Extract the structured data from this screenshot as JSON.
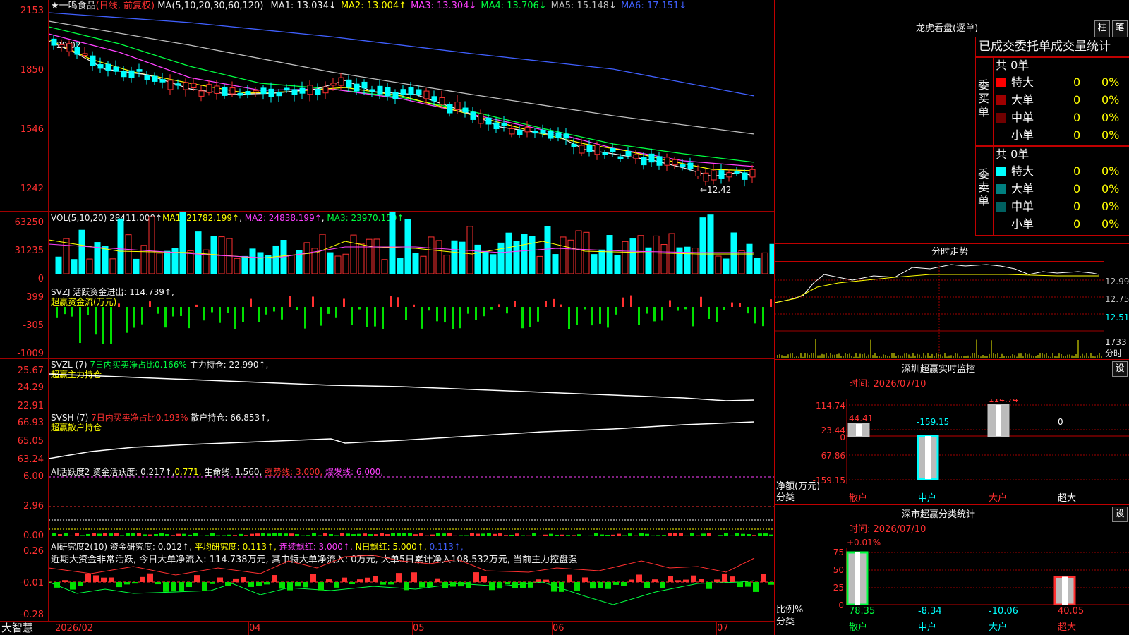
{
  "stock": {
    "title": "★一鸣食品",
    "mode": "(日线, 前复权)",
    "ma_label": "MA(5,10,20,30,60,120)",
    "ma": [
      {
        "k": "MA1:",
        "v": "13.034",
        "arrow": "↓",
        "color": "#f0f0f0"
      },
      {
        "k": "MA2:",
        "v": "13.004",
        "arrow": "↑",
        "color": "#ffff00"
      },
      {
        "k": "MA3:",
        "v": "13.304",
        "arrow": "↓",
        "color": "#ff40ff"
      },
      {
        "k": "MA4:",
        "v": "13.706",
        "arrow": "↓",
        "color": "#00ff40"
      },
      {
        "k": "MA5:",
        "v": "15.148",
        "arrow": "↓",
        "color": "#c0c0c0"
      },
      {
        "k": "MA6:",
        "v": "17.151",
        "arrow": "↓",
        "color": "#4060ff"
      }
    ],
    "axis": [
      "2153",
      "1850",
      "1546",
      "1242"
    ],
    "high_label": "20.02",
    "low_label": "←12.42"
  },
  "vol": {
    "label": "VOL(5,10,20)",
    "value": "28411.000↑",
    "ma1": "MA1: 21782.199↑",
    "ma2": "MA2: 24838.199↑",
    "ma3": "MA3: 23970.150↑",
    "axis": [
      "63250",
      "31235",
      "0"
    ]
  },
  "svzj": {
    "label": "SVZJ",
    "text": "活跃资金进出: 114.739↑,",
    "sub": "超赢资金流(万元)",
    "axis": [
      "399",
      "-305",
      "-1009"
    ]
  },
  "svzl": {
    "label": "SVZL (7)",
    "pct": "7日内买卖净占比0.166%",
    "hold": "主力持仓: 22.990↑,",
    "sub": "超赢主力持仓",
    "axis": [
      "25.67",
      "24.29",
      "22.91"
    ]
  },
  "svsh": {
    "label": "SVSH (7)",
    "pct": "7日内买卖净占比0.193%",
    "hold": "散户持仓: 66.853↑,",
    "sub": "超赢散户持仓",
    "axis": [
      "66.93",
      "65.05",
      "63.24"
    ]
  },
  "ai1": {
    "label": "AI活跃度2",
    "a": "资金活跃度: 0.217↑,",
    "b": "0.771,",
    "c": "生命线: 1.560,",
    "d": "强势线: 3.000,",
    "e": "爆发线: 6.000,",
    "axis": [
      "6.00",
      "2.96",
      "0.00"
    ]
  },
  "ai2": {
    "label": "AI研究度2(10)",
    "a": "资金研究度: 0.012↑,",
    "b": "平均研究度: 0.113↑,",
    "c": "连续飘红: 3.000↑,",
    "d": "N日飘红: 5.000↑,",
    "e": "0.113↑,",
    "note": "近期大资金非常活跃, 今日大单净流入: 114.738万元, 其中特大单净流入: 0万元, 大单5日累计净入108.532万元, 当前主力控盘强",
    "axis": [
      "0.26",
      "-0.01",
      "-0.28"
    ]
  },
  "xaxis": {
    "brand": "大智慧",
    "labels": [
      "2026/02",
      "04",
      "05",
      "06",
      "07"
    ]
  },
  "right": {
    "title": "龙虎看盘(逐单)",
    "btn1": "柱",
    "btn2": "笔",
    "subtitle": "已成交委托单成交量统计",
    "buy": {
      "side": "委买单",
      "total": "共 0单",
      "rows": [
        {
          "name": "特大",
          "n": "0",
          "p": "0%",
          "c": "#ff0000"
        },
        {
          "name": "大单",
          "n": "0",
          "p": "0%",
          "c": "#a00000"
        },
        {
          "name": "中单",
          "n": "0",
          "p": "0%",
          "c": "#700000"
        },
        {
          "name": "小单",
          "n": "0",
          "p": "0%",
          "c": "#000000"
        }
      ]
    },
    "sell": {
      "side": "委卖单",
      "total": "共 0单",
      "rows": [
        {
          "name": "特大",
          "n": "0",
          "p": "0%",
          "c": "#00ffff"
        },
        {
          "name": "大单",
          "n": "0",
          "p": "0%",
          "c": "#008080"
        },
        {
          "name": "中单",
          "n": "0",
          "p": "0%",
          "c": "#006060"
        },
        {
          "name": "小单",
          "n": "0",
          "p": "0%",
          "c": "#000000"
        }
      ]
    },
    "intraday": {
      "title": "分时走势",
      "axis": [
        "12.99",
        "12.75",
        "12.51"
      ],
      "vol": "1733",
      "vol_label": "分时"
    },
    "monitor": {
      "title": "深圳超赢实时监控",
      "set": "设",
      "time": "时间: 2026/07/10",
      "axis": [
        "114.74",
        "23.44",
        "0",
        "-67.86",
        "-159.15"
      ],
      "unit": "净额(万元)",
      "cat": "分类",
      "cats": [
        "散户",
        "中户",
        "大户",
        "超大"
      ],
      "values": [
        "44.41",
        "-159.15",
        "114.74",
        "0"
      ]
    },
    "classify": {
      "title": "深市超赢分类统计",
      "set": "设",
      "time": "时间: 2026/07/10",
      "axis": [
        "75",
        "50",
        "25",
        "0"
      ],
      "unit": "比例%",
      "cat": "分类",
      "cats": [
        "散户",
        "中户",
        "大户",
        "超大"
      ],
      "top": "+0.01%",
      "values": [
        "78.35",
        "-8.34",
        "-10.06",
        "40.05"
      ]
    }
  }
}
